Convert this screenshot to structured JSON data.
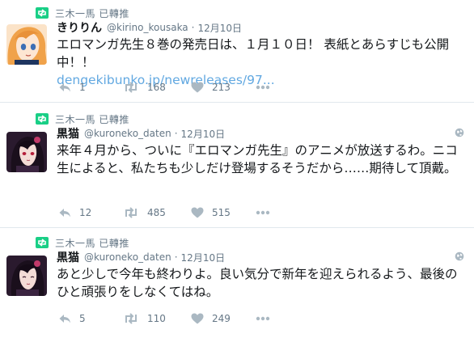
{
  "tweets": [
    {
      "retweeted_by": "三木一馬 已轉推",
      "name": "きりりん",
      "handle": "@kirino_kousaka",
      "separator": "·",
      "time": "12月10日",
      "text": "エロマンガ先生８巻の発売日は、１月１０日！ 表紙とあらすじも公開中！！",
      "link": "dengekibunko.jp/newreleases/97...",
      "replies": "1",
      "retweets": "168",
      "likes": "213",
      "avatar": "anime-girl-orange-hair-avatar"
    },
    {
      "retweeted_by": "三木一馬 已轉推",
      "name": "黒猫",
      "handle": "@kuroneko_daten",
      "separator": "·",
      "time": "12月10日",
      "text": "来年４月から、ついに『エロマンガ先生』のアニメが放送するわ。ニコ生によると、私たちも少しだけ登場するそうだから……期待して頂戴。",
      "replies": "12",
      "retweets": "485",
      "likes": "515",
      "avatar": "anime-girl-black-hair-avatar"
    },
    {
      "retweeted_by": "三木一馬 已轉推",
      "name": "黒猫",
      "handle": "@kuroneko_daten",
      "separator": "·",
      "time": "12月10日",
      "text": "あと少しで今年も終わりよ。良い気分で新年を迎えられるよう、最後のひと頑張りをしなくてはね。",
      "replies": "5",
      "retweets": "110",
      "likes": "249",
      "avatar": "anime-girl-black-hair-avatar"
    }
  ],
  "colors": {
    "retweet_green": "#19cf86",
    "muted": "#657786",
    "link": "#61a8e1",
    "icon_gray": "#aab8c2",
    "divider": "#e1e8ed"
  }
}
